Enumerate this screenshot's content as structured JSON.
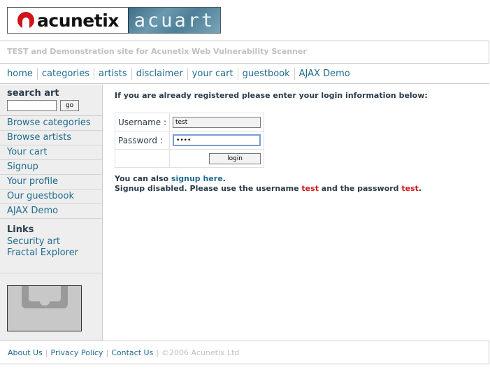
{
  "logo": {
    "brand": "acunetix",
    "product": "acuart"
  },
  "subtitle": "TEST and Demonstration site for Acunetix Web Vulnerability Scanner",
  "topnav": [
    "home",
    "categories",
    "artists",
    "disclaimer",
    "your cart",
    "guestbook",
    "AJAX Demo"
  ],
  "sidebar": {
    "search_title": "search art",
    "search_value": "",
    "go_label": "go",
    "links": [
      "Browse categories",
      "Browse artists",
      "Your cart",
      "Signup",
      "Your profile",
      "Our guestbook",
      "AJAX Demo"
    ],
    "links_title": "Links",
    "external_links": [
      "Security art",
      "Fractal Explorer"
    ]
  },
  "main": {
    "intro": "If you are already registered please enter your login information below:",
    "username_label": "Username :",
    "username_value": "test",
    "password_label": "Password :",
    "password_value": "••••",
    "login_label": "login",
    "signup_prefix": "You can also",
    "signup_link": "signup here",
    "signup_suffix": ".",
    "disabled_prefix": "Signup disabled. Please use the username",
    "disabled_username": "test",
    "disabled_middle": "and the password",
    "disabled_password": "test",
    "disabled_suffix": "."
  },
  "footer": {
    "about": "About Us",
    "privacy": "Privacy Policy",
    "contact": "Contact Us",
    "sep": "|",
    "copyright": "©2006 Acunetix Ltd"
  }
}
